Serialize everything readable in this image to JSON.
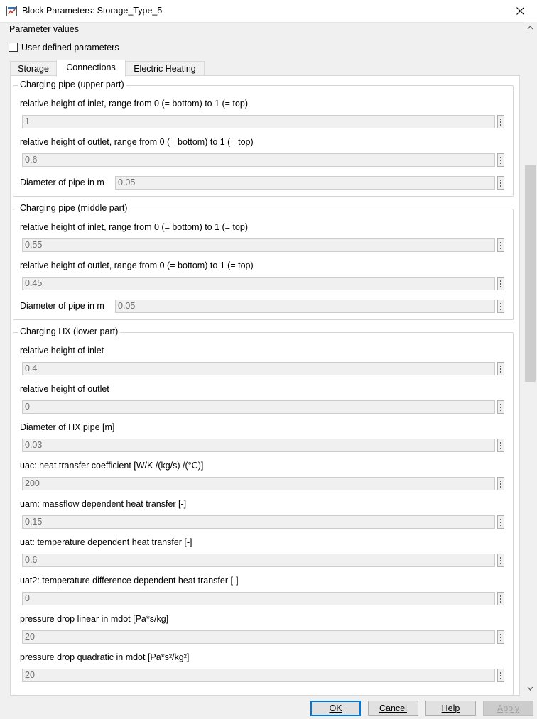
{
  "window": {
    "title": "Block Parameters: Storage_Type_5"
  },
  "section_title": "Parameter values",
  "user_defined": {
    "label": "User defined parameters",
    "checked": false
  },
  "tabs": [
    "Storage",
    "Connections",
    "Electric Heating"
  ],
  "active_tab": "Connections",
  "groups": [
    {
      "legend": "Charging pipe (upper part)",
      "params": [
        {
          "label": "relative height of inlet, range from 0 (= bottom) to 1 (= top)",
          "value": "1"
        },
        {
          "label": "relative height of outlet, range from 0 (= bottom) to 1 (= top)",
          "value": "0.6"
        },
        {
          "label": "Diameter of pipe in m",
          "value": "0.05"
        }
      ]
    },
    {
      "legend": "Charging pipe (middle part)",
      "params": [
        {
          "label": "relative height of inlet, range from 0 (= bottom) to 1 (= top)",
          "value": "0.55"
        },
        {
          "label": "relative height of outlet, range from 0 (= bottom) to 1 (= top)",
          "value": "0.45"
        },
        {
          "label": "Diameter of pipe in m",
          "value": "0.05"
        }
      ]
    },
    {
      "legend": "Charging HX (lower part)",
      "params": [
        {
          "label": "relative height of inlet",
          "value": "0.4"
        },
        {
          "label": "relative height of outlet",
          "value": "0"
        },
        {
          "label": "Diameter of HX pipe [m]",
          "value": "0.03"
        },
        {
          "label": "uac: heat transfer coefficient [W/K /(kg/s) /(°C)]",
          "value": "200"
        },
        {
          "label": "uam: massflow dependent heat transfer [-]",
          "value": "0.15"
        },
        {
          "label": "uat: temperature dependent heat transfer [-]",
          "value": "0.6"
        },
        {
          "label": "uat2: temperature difference dependent heat transfer [-]",
          "value": "0"
        },
        {
          "label": "pressure drop linear in mdot [Pa*s/kg]",
          "value": "20"
        },
        {
          "label": "pressure drop quadratic in mdot [Pa*s²/kg²]",
          "value": "20"
        }
      ]
    }
  ],
  "buttons": {
    "ok": "OK",
    "cancel": "Cancel",
    "help": "Help",
    "apply": "Apply"
  },
  "colors": {
    "accent": "#0078d7",
    "disabled_field": "#f0f0f0",
    "disabled_text": "#6d6d6d"
  }
}
